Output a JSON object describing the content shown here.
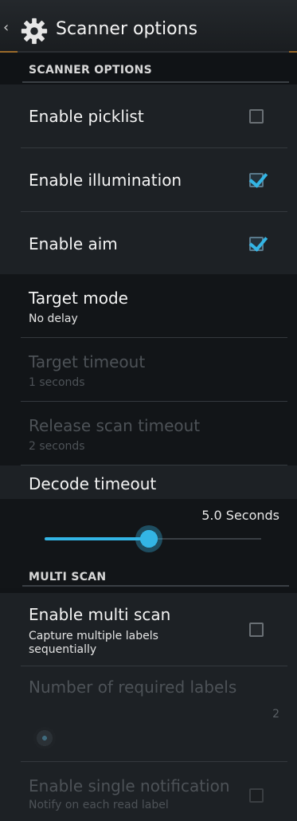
{
  "action_bar": {
    "title": "Scanner options",
    "icon": "gear-icon",
    "up_icon": "chevron-left-icon"
  },
  "sections": {
    "scanner_options": "SCANNER OPTIONS",
    "multi_scan": "MULTI SCAN"
  },
  "prefs": {
    "picklist": {
      "title": "Enable picklist",
      "checked": false
    },
    "illumination": {
      "title": "Enable illumination",
      "checked": true
    },
    "aim": {
      "title": "Enable aim",
      "checked": true
    },
    "target_mode": {
      "title": "Target mode",
      "summary": "No delay"
    },
    "target_timeout": {
      "title": "Target timeout",
      "summary": "1 seconds",
      "enabled": false
    },
    "release_timeout": {
      "title": "Release scan timeout",
      "summary": "2 seconds",
      "enabled": false
    },
    "decode_timeout": {
      "title": "Decode timeout",
      "value_label": "5.0 Seconds",
      "fraction": 0.48
    },
    "multi_scan": {
      "title": "Enable multi scan",
      "summary": "Capture multiple labels sequentially",
      "checked": false
    },
    "required_labels": {
      "title": "Number of required labels",
      "value_label": "2",
      "enabled": false,
      "fraction": 0.0
    },
    "single_notification": {
      "title": "Enable single notification",
      "summary": "Notify on each read label",
      "enabled": false,
      "checked": false
    }
  },
  "colors": {
    "accent": "#33b5e5",
    "background": "#1d2125",
    "disabled_text": "#4d5257"
  }
}
